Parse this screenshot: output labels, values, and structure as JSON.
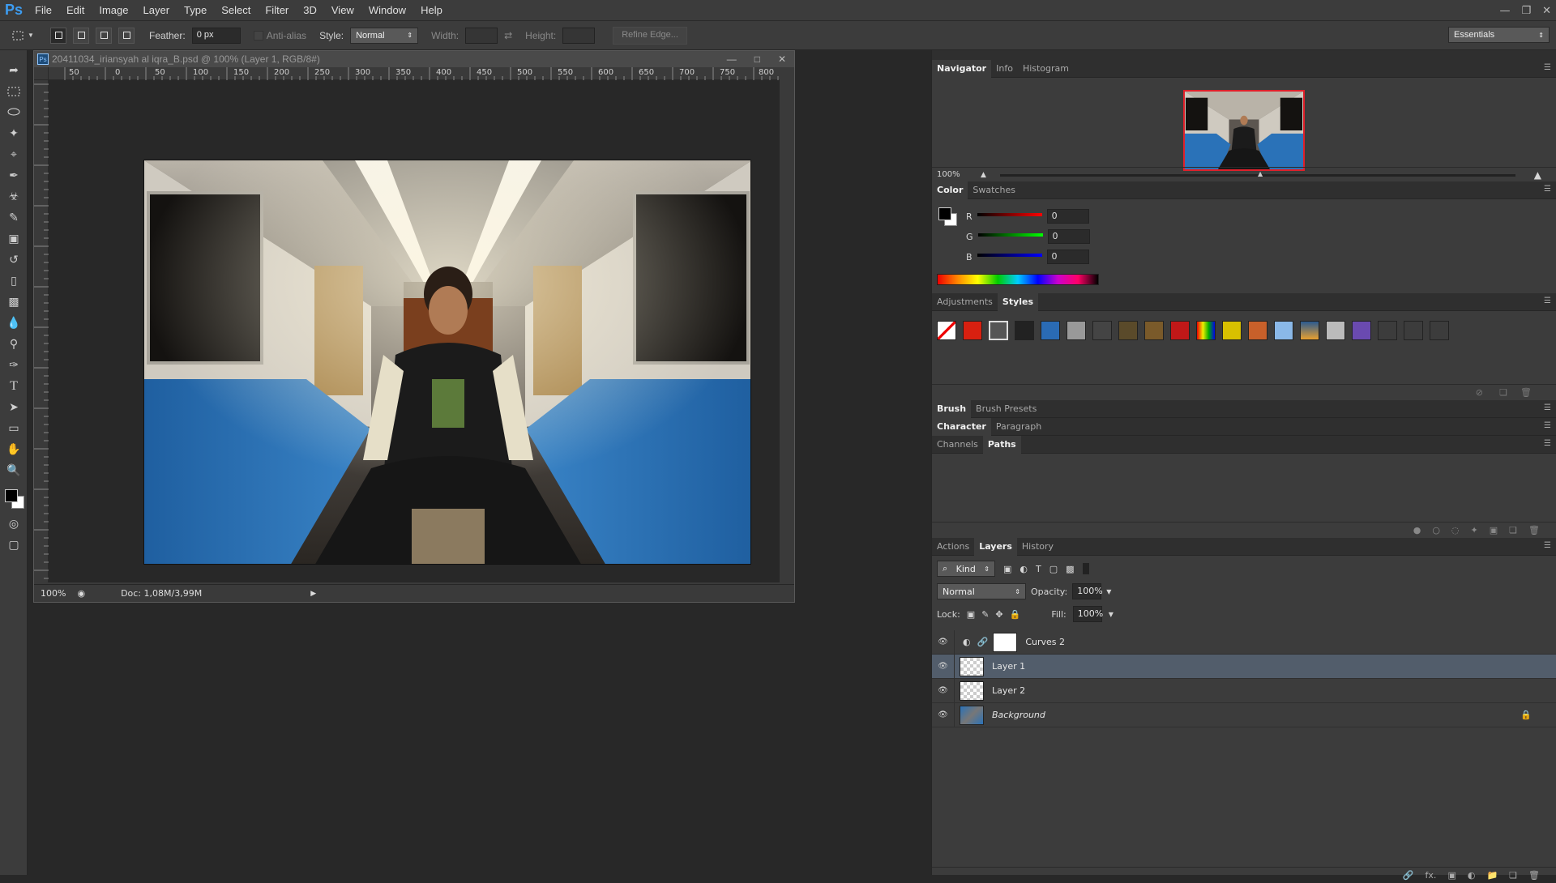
{
  "menubar": {
    "logo": "Ps",
    "items": [
      "File",
      "Edit",
      "Image",
      "Layer",
      "Type",
      "Select",
      "Filter",
      "3D",
      "View",
      "Window",
      "Help"
    ]
  },
  "options": {
    "feather_label": "Feather:",
    "feather_value": "0 px",
    "antialias_label": "Anti-alias",
    "style_label": "Style:",
    "style_value": "Normal",
    "width_label": "Width:",
    "height_label": "Height:",
    "refine_edge": "Refine Edge...",
    "workspace": "Essentials"
  },
  "document": {
    "title": "20411034_iriansyah al iqra_B.psd @ 100% (Layer 1, RGB/8#)",
    "zoom": "100%",
    "doc_info": "Doc: 1,08M/3,99M",
    "ruler_ticks": [
      "50",
      "0",
      "50",
      "100",
      "150",
      "200",
      "250",
      "300",
      "350",
      "400",
      "450",
      "500",
      "550",
      "600",
      "650",
      "700",
      "750",
      "800"
    ]
  },
  "panels": {
    "nav_tabs": [
      "Navigator",
      "Info",
      "Histogram"
    ],
    "nav_zoom": "100%",
    "color_tabs": [
      "Color",
      "Swatches"
    ],
    "color": {
      "r_label": "R",
      "g_label": "G",
      "b_label": "B",
      "r": "0",
      "g": "0",
      "b": "0"
    },
    "adj_tabs": [
      "Adjustments",
      "Styles"
    ],
    "brush_tabs": [
      "Brush",
      "Brush Presets"
    ],
    "char_tabs": [
      "Character",
      "Paragraph"
    ],
    "channel_tabs": [
      "Channels",
      "Paths"
    ],
    "layer_tabs": [
      "Actions",
      "Layers",
      "History"
    ],
    "layers": {
      "kind": "Kind",
      "blend_mode": "Normal",
      "opacity_label": "Opacity:",
      "opacity": "100%",
      "lock_label": "Lock:",
      "fill_label": "Fill:",
      "fill": "100%",
      "items": [
        {
          "name": "Curves 2"
        },
        {
          "name": "Layer 1"
        },
        {
          "name": "Layer 2"
        },
        {
          "name": "Background"
        }
      ]
    }
  },
  "colors": {
    "accent": "#3d9df2",
    "selection": "#525d6b",
    "nav_frame": "#e0202a"
  }
}
